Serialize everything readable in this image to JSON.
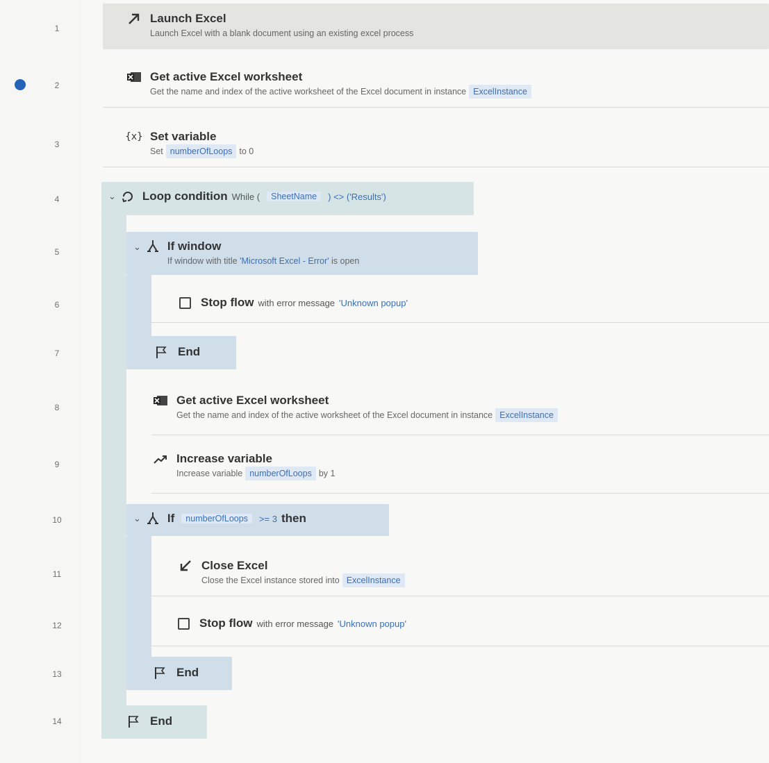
{
  "line_numbers": [
    "1",
    "2",
    "3",
    "4",
    "5",
    "6",
    "7",
    "8",
    "9",
    "10",
    "11",
    "12",
    "13",
    "14"
  ],
  "actions": {
    "launch_excel": {
      "title": "Launch Excel",
      "desc": "Launch Excel with a blank document using an existing excel process"
    },
    "get_ws_1": {
      "title": "Get active Excel worksheet",
      "desc": "Get the name and index of the active worksheet of the Excel document in instance",
      "var": "ExcelInstance"
    },
    "set_var": {
      "title": "Set variable",
      "prefix": "Set",
      "var": "numberOfLoops",
      "suffix": "to 0"
    },
    "loop": {
      "title": "Loop condition",
      "prefix": "While (",
      "var": "SheetName",
      "suffix": ") <> ('Results')"
    },
    "if_window": {
      "title": "If window",
      "prefix": "If window with title",
      "value": "'Microsoft Excel - Error'",
      "suffix": "is open"
    },
    "stop_flow_1": {
      "title": "Stop flow",
      "prefix": "with error message",
      "value": "'Unknown popup'"
    },
    "end_1": {
      "title": "End"
    },
    "get_ws_2": {
      "title": "Get active Excel worksheet",
      "desc": "Get the name and index of the active worksheet of the Excel document in instance",
      "var": "ExcelInstance"
    },
    "increase_var": {
      "title": "Increase variable",
      "prefix": "Increase variable",
      "var": "numberOfLoops",
      "suffix": "by 1"
    },
    "if_loops": {
      "title": "If",
      "var": "numberOfLoops",
      "op": ">= 3",
      "then": "then"
    },
    "close_excel": {
      "title": "Close Excel",
      "desc": "Close the Excel instance stored into",
      "var": "ExcelInstance"
    },
    "stop_flow_2": {
      "title": "Stop flow",
      "prefix": "with error message",
      "value": "'Unknown popup'"
    },
    "end_2": {
      "title": "End"
    },
    "end_3": {
      "title": "End"
    }
  },
  "colors": {
    "accent": "#3a6fb6",
    "block": "#d6e4e6",
    "breakpoint": "#2463b8"
  }
}
